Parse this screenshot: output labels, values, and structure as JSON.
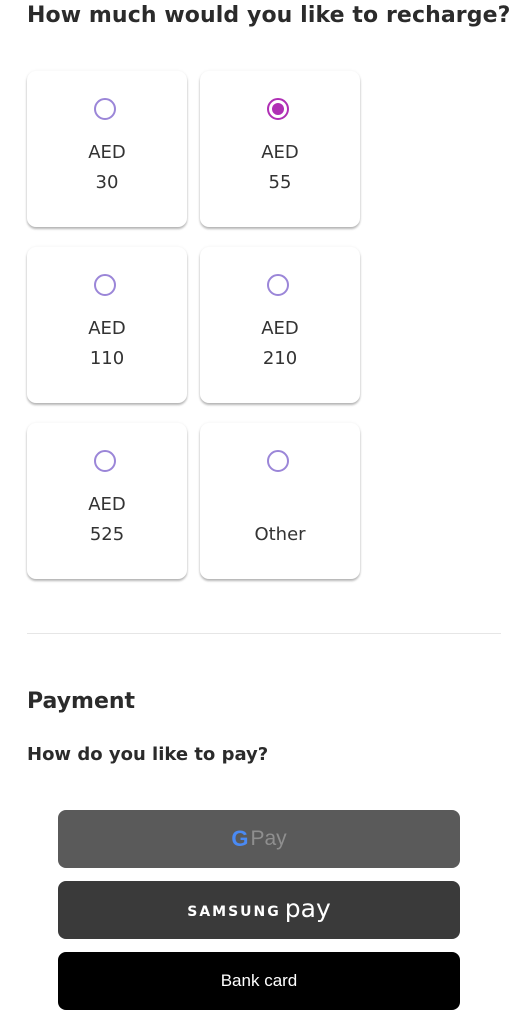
{
  "recharge": {
    "title": "How much would you like to recharge?",
    "options": [
      {
        "currency": "AED",
        "amount": "30",
        "selected": false
      },
      {
        "currency": "AED",
        "amount": "55",
        "selected": true
      },
      {
        "currency": "AED",
        "amount": "110",
        "selected": false
      },
      {
        "currency": "AED",
        "amount": "210",
        "selected": false
      },
      {
        "currency": "AED",
        "amount": "525",
        "selected": false
      },
      {
        "currency": "",
        "amount": "Other",
        "selected": false
      }
    ]
  },
  "payment": {
    "title": "Payment",
    "question": "How do you like to pay?",
    "gpay": {
      "g_letter": "G",
      "label": "Pay"
    },
    "samsung": {
      "brand": "SAMSUNG",
      "label": "pay"
    },
    "bank_card": {
      "label": "Bank card"
    }
  },
  "colors": {
    "radio_unselected": "#9b86d8",
    "radio_selected": "#b02fb5",
    "gpay_button": "#5a5a5a",
    "samsung_button": "#3a3a3a",
    "bank_button": "#000000"
  }
}
